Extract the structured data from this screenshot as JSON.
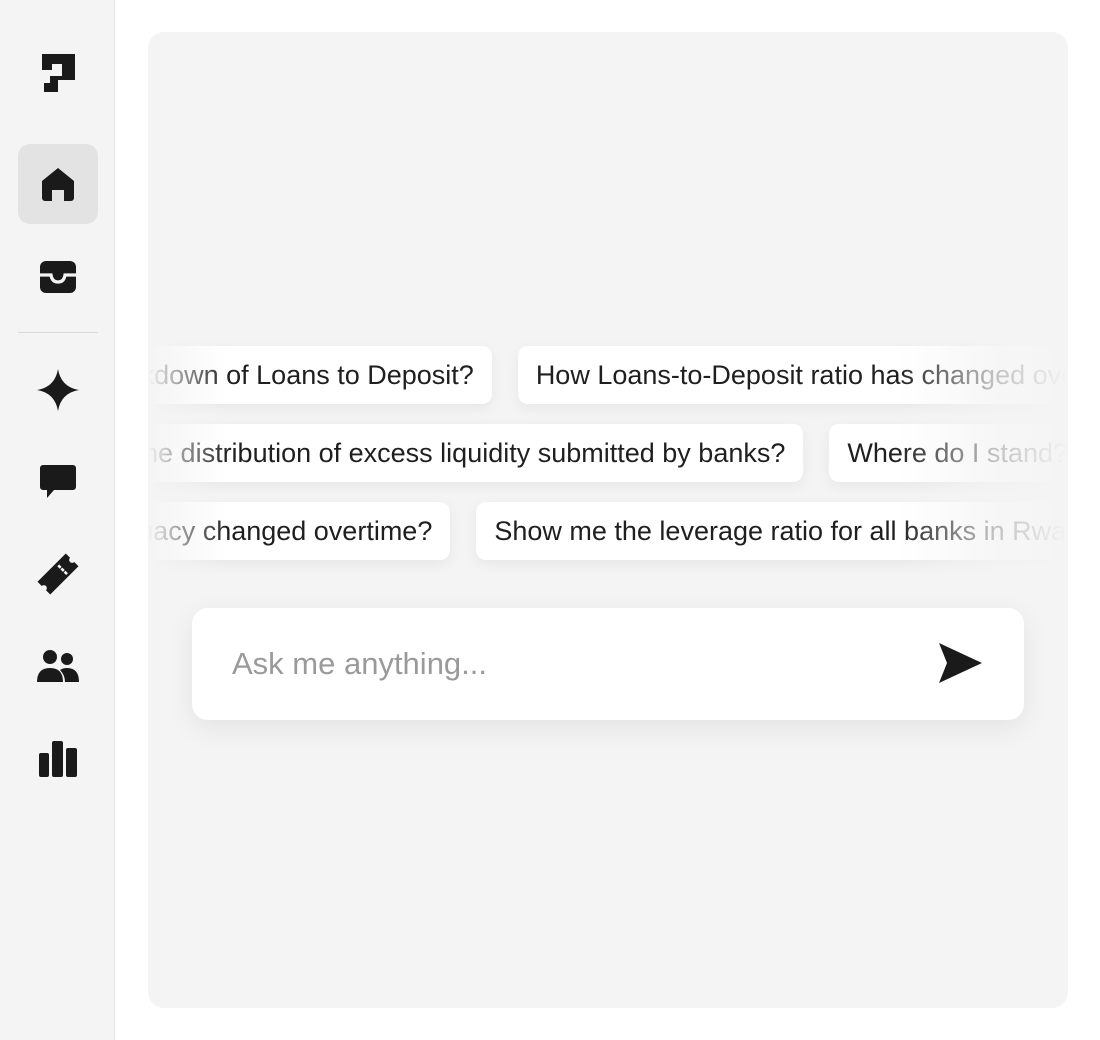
{
  "sidebar": {
    "logo": "logo-mark",
    "nav": [
      {
        "name": "home",
        "icon": "home-icon",
        "active": true
      },
      {
        "name": "inbox",
        "icon": "inbox-icon",
        "active": false
      },
      {
        "name": "ai",
        "icon": "sparkle-icon",
        "active": false
      },
      {
        "name": "chat",
        "icon": "chat-bubble-icon",
        "active": false
      },
      {
        "name": "tickets",
        "icon": "ticket-icon",
        "active": false
      },
      {
        "name": "users",
        "icon": "users-icon",
        "active": false
      },
      {
        "name": "analytics",
        "icon": "bar-chart-icon",
        "active": false
      }
    ]
  },
  "suggestions": {
    "row1": [
      "What is the breakdown of Loans to Deposit?",
      "How Loans-to-Deposit ratio has changed overtime?"
    ],
    "row2": [
      "What is the distribution of excess liquidity submitted by banks?",
      "Where do I stand?"
    ],
    "row3": [
      "How has capital adequacy changed overtime?",
      "Show me the leverage ratio for all banks in Rwanda"
    ]
  },
  "chat": {
    "placeholder": "Ask me anything...",
    "send_icon": "send-icon"
  },
  "colors": {
    "sidebar_bg": "#f4f4f4",
    "panel_bg": "#f4f4f4",
    "active_item_bg": "#e3e3e3",
    "icon": "#1a1a1a",
    "chip_bg": "#ffffff",
    "placeholder": "#9a9a9a"
  }
}
